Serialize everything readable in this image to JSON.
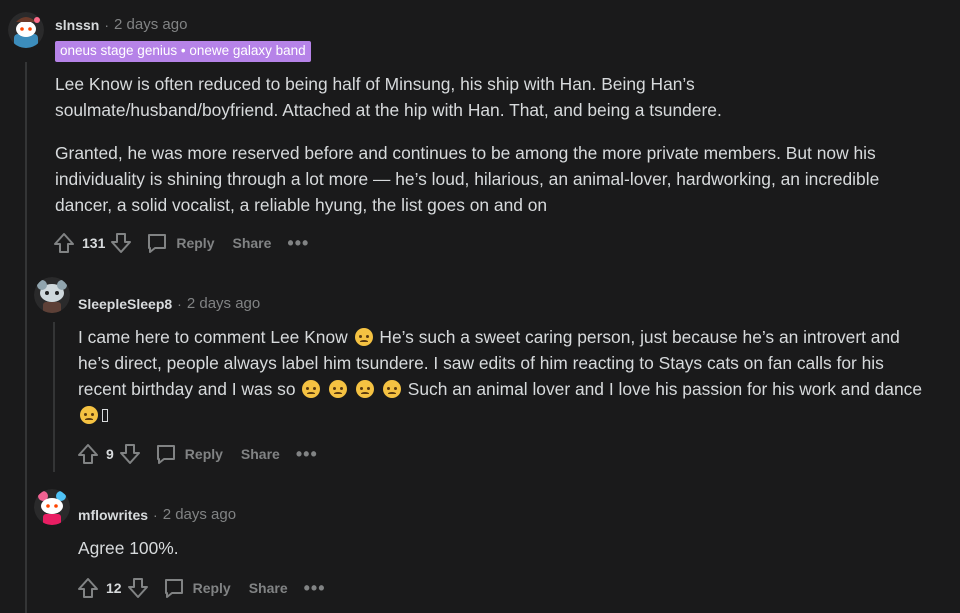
{
  "comments": [
    {
      "username": "slnssn",
      "time": "2 days ago",
      "flair": "oneus stage genius • onewe galaxy band",
      "paragraphs": [
        "Lee Know is often reduced to being half of Minsung, his ship with Han. Being Han’s soulmate/husband/boyfriend. Attached at the hip with Han. That, and being a tsundere.",
        "Granted, he was more reserved before and continues to be among the more private members. But now his individuality is shining through a lot more — he’s loud, hilarious, an animal-lover, hardworking, an incredible dancer, a solid vocalist, a reliable hyung, the list goes on and on"
      ],
      "votes": "131",
      "reply_label": "Reply",
      "share_label": "Share",
      "more_label": "•••"
    },
    {
      "username": "SleepleSleep8",
      "time": "2 days ago",
      "body_parts": {
        "line1a": "I came here to comment Lee Know",
        "line1b": "He’s such a sweet caring person, just because he’s an introvert and",
        "line2": "he’s direct, people always label him tsundere. I saw edits of him reacting to Stays cats on fan calls for his",
        "line3a": "recent birthday and I was so",
        "line3b": "Such an animal lover and I love his passion for his work and dance"
      },
      "votes": "9",
      "reply_label": "Reply",
      "share_label": "Share",
      "more_label": "•••"
    },
    {
      "username": "mflowrites",
      "time": "2 days ago",
      "body": "Agree 100%.",
      "votes": "12",
      "reply_label": "Reply",
      "share_label": "Share",
      "more_label": "•••"
    }
  ],
  "separator": "·",
  "icons": {
    "upvote": "upvote-icon",
    "downvote": "downvote-icon",
    "comment": "comment-bubble-icon",
    "emoji": "pleading-face-emoji-icon"
  },
  "colors": {
    "background": "#1a1a1b",
    "flair": "#b683e8",
    "meta": "#818384",
    "text": "#d7dadc"
  }
}
